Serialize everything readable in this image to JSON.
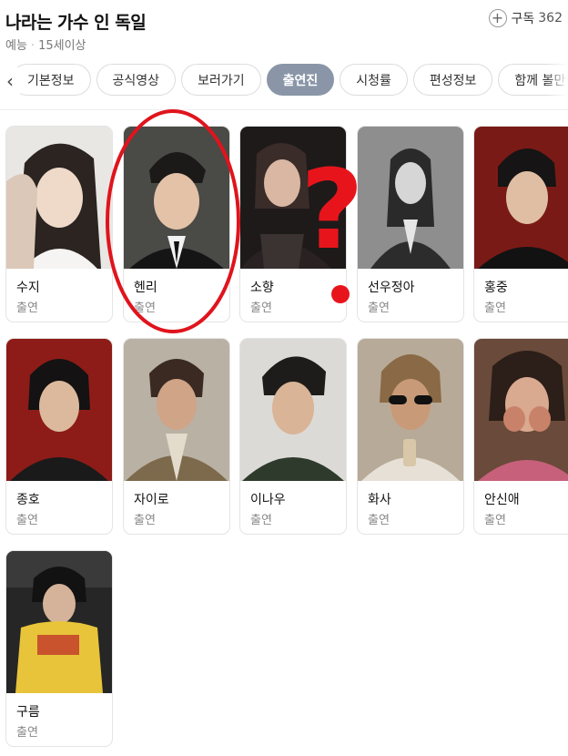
{
  "program": {
    "title": "나라는 가수 인 독일",
    "genre": "예능",
    "separator": "·",
    "rating": "15세이상"
  },
  "subscribe": {
    "label": "구독",
    "count": "362"
  },
  "tabs": [
    {
      "label": "기본정보"
    },
    {
      "label": "공식영상"
    },
    {
      "label": "보러가기"
    },
    {
      "label": "출연진"
    },
    {
      "label": "시청률"
    },
    {
      "label": "편성정보"
    },
    {
      "label": "함께 볼만한"
    }
  ],
  "cast": [
    {
      "name": "수지",
      "role": "출연"
    },
    {
      "name": "헨리",
      "role": "출연"
    },
    {
      "name": "소향",
      "role": "출연"
    },
    {
      "name": "선우정아",
      "role": "출연"
    },
    {
      "name": "홍중",
      "role": "출연"
    },
    {
      "name": "종호",
      "role": "출연"
    },
    {
      "name": "자이로",
      "role": "출연"
    },
    {
      "name": "이나우",
      "role": "출연"
    },
    {
      "name": "화사",
      "role": "출연"
    },
    {
      "name": "안신애",
      "role": "출연"
    },
    {
      "name": "구름",
      "role": "출연"
    }
  ],
  "annotation": {
    "question_mark": "?",
    "color": "#e8141c"
  }
}
